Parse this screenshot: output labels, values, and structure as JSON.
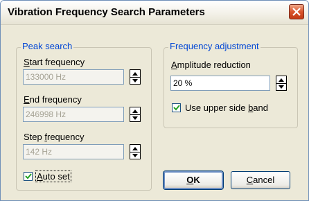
{
  "window": {
    "title": "Vibration Frequency Search Parameters"
  },
  "peak_search": {
    "legend": "Peak search",
    "start_label_u": "S",
    "start_label_rest": "tart frequency",
    "start_value": "133000 Hz",
    "end_label_u": "E",
    "end_label_rest": "nd frequency",
    "end_value": "246998 Hz",
    "step_label_pre": "Step ",
    "step_label_u": "f",
    "step_label_rest": "requency",
    "step_value": "142 Hz",
    "auto_u": "A",
    "auto_rest": "uto set",
    "auto_checked": true
  },
  "freq_adjust": {
    "legend": "Frequency adjustment",
    "amp_label_u": "A",
    "amp_label_rest": "mplitude reduction",
    "amp_value": "20 %",
    "upper_pre": "Use upper side ",
    "upper_u": "b",
    "upper_rest": "and",
    "upper_checked": true
  },
  "buttons": {
    "ok_u": "O",
    "ok_rest": "K",
    "cancel_u": "C",
    "cancel_rest": "ancel"
  },
  "colors": {
    "legend": "#0046d5",
    "disabled_text": "#a6a395",
    "close": "#d9542c"
  }
}
